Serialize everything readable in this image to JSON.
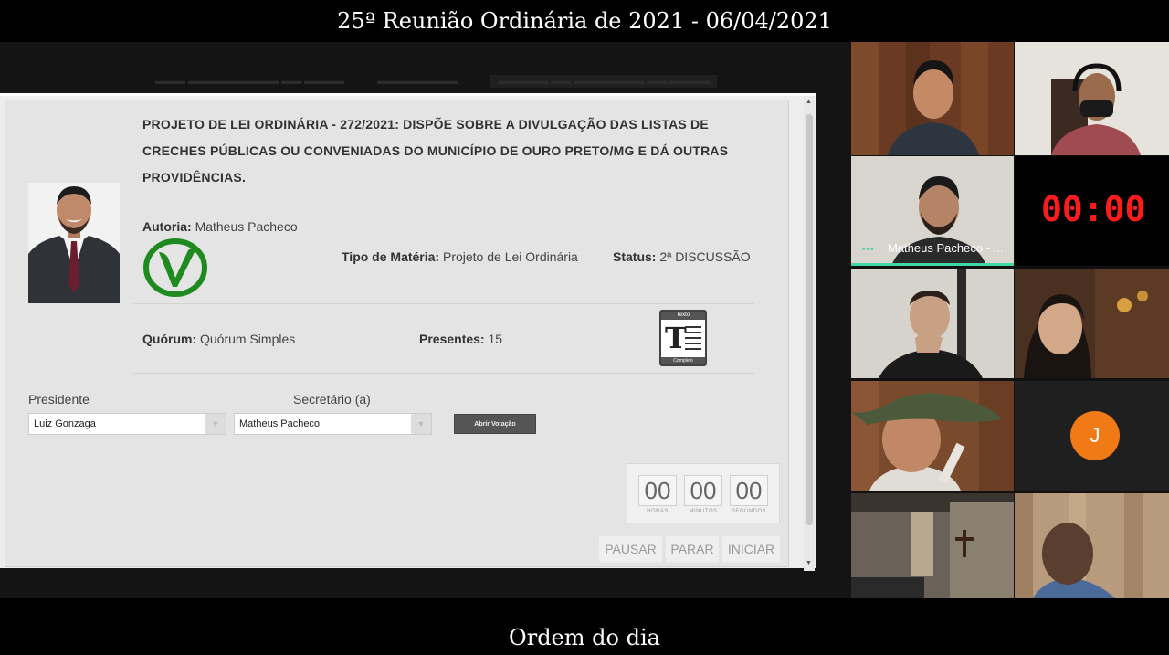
{
  "meeting": {
    "title": "25ª Reunião Ordinária de 2021 - 06/04/2021",
    "caption": "Ordem do dia"
  },
  "materia": {
    "headline": "PROJETO DE LEI ORDINÁRIA - 272/2021: DISPÕE SOBRE A DIVULGAÇÃO DAS LISTAS DE CRECHES PÚBLICAS OU CONVENIADAS DO MUNICÍPIO DE OURO PRETO/MG E DÁ OUTRAS PROVIDÊNCIAS.",
    "autoria_label": "Autoria:",
    "autoria_value": "Matheus Pacheco",
    "tipo_label": "Tipo de Matéria:",
    "tipo_value": "Projeto de Lei Ordinária",
    "status_label": "Status:",
    "status_value": "2ª DISCUSSÃO",
    "quorum_label": "Quórum:",
    "quorum_value": "Quórum Simples",
    "presentes_label": "Presentes:",
    "presentes_value": "15",
    "texto_icon_top": "Texto",
    "texto_icon_bottom": "Completo"
  },
  "controls": {
    "presidente_label": "Presidente",
    "presidente_value": "Luiz Gonzaga",
    "secretario_label": "Secretário (a)",
    "secretario_value": "Matheus Pacheco",
    "abrir_votacao": "Abrir Votação"
  },
  "timer": {
    "hours": "00",
    "minutes": "00",
    "seconds": "00",
    "hours_caption": "HORAS",
    "minutes_caption": "MINUTOS",
    "seconds_caption": "SEGUNDOS",
    "pause_label": "PAUSAR",
    "stop_label": "PARAR",
    "start_label": "INICIAR"
  },
  "video": {
    "speaker_name": "Matheus Pacheco - ...",
    "clock": "00:00",
    "avatar_initial": "J",
    "speaker_highlight_color": "#3fd6a8",
    "clock_color": "#ff1b1b",
    "avatar_color": "#f07a16"
  }
}
